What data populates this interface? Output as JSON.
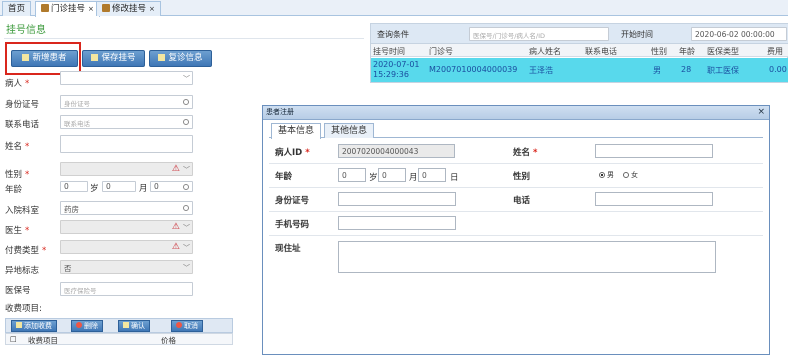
{
  "tabs": [
    {
      "label": "首页"
    },
    {
      "label": "门诊挂号",
      "close": "×"
    },
    {
      "label": "修改挂号",
      "close": "×"
    }
  ],
  "section_title": "挂号信息",
  "toolbar": {
    "new_patient": "新增患者",
    "save_reg": "保存挂号",
    "revisit": "复诊信息"
  },
  "form": {
    "patient": "病人",
    "id_card": "身份证号",
    "id_card_ph": "身份证号",
    "phone": "联系电话",
    "phone_ph": "联系电话",
    "name": "姓名",
    "gender": "性别",
    "age": "年龄",
    "age_y": "0",
    "age_y_unit": "岁",
    "age_m": "0",
    "age_m_unit": "月",
    "age_d": "0",
    "dept": "入院科室",
    "dept_val": "药房",
    "doctor": "医生",
    "pay_type": "付费类型",
    "remote": "异地标志",
    "remote_val": "否",
    "insurance": "医保号",
    "insurance_ph": "医疗保险号",
    "charge_items": "收费项目:"
  },
  "grid": {
    "add": "添加收费",
    "del": "删除",
    "confirm": "确认",
    "cancel": "取消",
    "col_item": "收费项目",
    "col_price": "价格"
  },
  "query": {
    "label": "查询条件",
    "placeholder": "医保号/门诊号/病人名/ID",
    "start_label": "开始时间",
    "start_val": "2020-06-02 00:00:00"
  },
  "table": {
    "headers": [
      "挂号时间",
      "门诊号",
      "病人姓名",
      "联系电话",
      "性别",
      "年龄",
      "医保类型",
      "费用"
    ],
    "row": {
      "time": "2020-07-01 15:29:36",
      "clinic_no": "M2007010004000039",
      "name": "王泽浩",
      "phone": "",
      "gender": "男",
      "age": "28",
      "ins_type": "职工医保",
      "fee": "0.00"
    }
  },
  "modal": {
    "title": "患者注册",
    "close": "×",
    "tab_basic": "基本信息",
    "tab_other": "其他信息",
    "patient_id_label": "病人ID",
    "patient_id": "2007020004000043",
    "name_label": "姓名",
    "age_label": "年龄",
    "age_y": "0",
    "age_y_unit": "岁",
    "age_m": "0",
    "age_m_unit": "月",
    "age_d": "0",
    "age_d_unit": "日",
    "gender_label": "性别",
    "male": "男",
    "female": "女",
    "idcard_label": "身份证号",
    "phone_label": "电话",
    "mobile_label": "手机号码",
    "address_label": "现住址"
  }
}
